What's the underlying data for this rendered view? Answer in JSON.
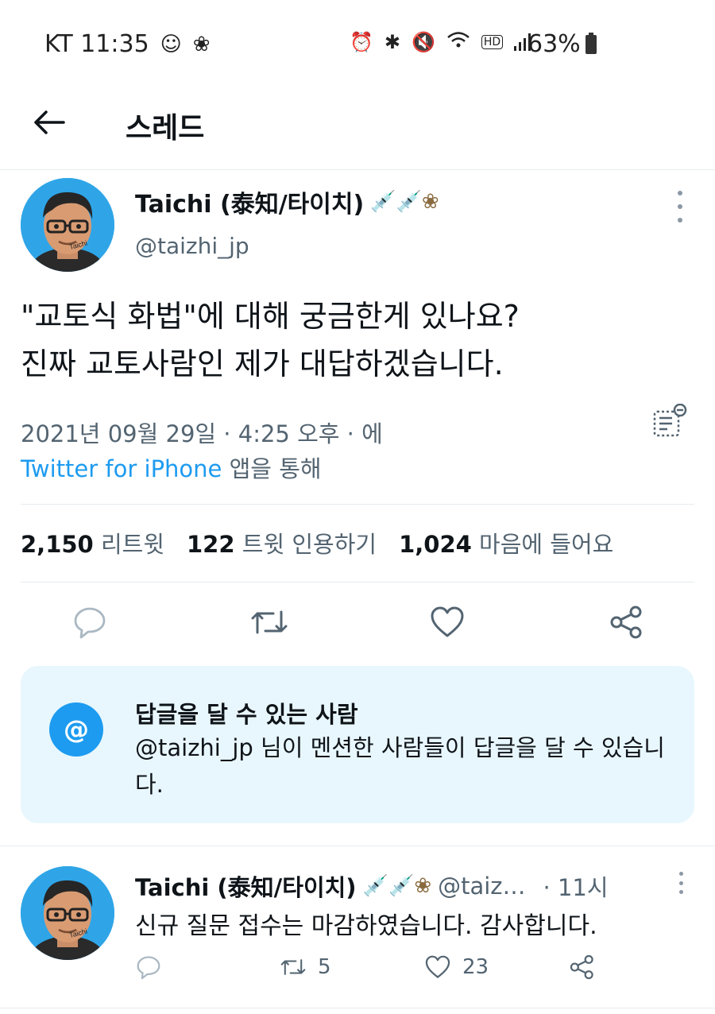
{
  "status_bar": {
    "carrier_time": "KT 11:35",
    "battery": "63%",
    "icons": [
      "person-icon",
      "flower-icon",
      "alarm-icon",
      "bluetooth-icon",
      "mute-icon",
      "wifi-icon",
      "hd-icon",
      "signal-icon",
      "battery-icon"
    ]
  },
  "header": {
    "title": "스레드"
  },
  "tweet": {
    "display_name": "Taichi (泰知/타이치)",
    "name_emoji": "💉💉❀",
    "handle": "@taizhi_jp",
    "text_line1": "\"교토식 화법\"에 대해 궁금한게 있나요?",
    "text_line2": "진짜 교토사람인 제가 대답하겠습니다.",
    "timestamp": "2021년 09월 29일 · 4:25 오후 · 에",
    "source_app": "Twitter for iPhone",
    "source_suffix": " 앱을 통해",
    "stats": {
      "retweets_count": "2,150",
      "retweets_label": "리트윗",
      "quotes_count": "122",
      "quotes_label": "트윗 인용하기",
      "likes_count": "1,024",
      "likes_label": "마음에 들어요"
    }
  },
  "reply_notice": {
    "icon_symbol": "@",
    "title": "답글을 달 수 있는 사람",
    "body": "@taizhi_jp 님이 멘션한 사람들이 답글을 달 수 있습니다."
  },
  "reply": {
    "display_name": "Taichi (泰知/타이치)",
    "name_emoji": "💉💉❀",
    "handle": "@taiz…",
    "time": "· 11시",
    "text": "신규 질문 접수는 마감하였습니다. 감사합니다.",
    "retweets": "5",
    "likes": "23"
  },
  "colors": {
    "accent": "#1d9bf0",
    "text": "#0f1419",
    "muted": "#536471",
    "notice_bg": "#e8f7fd"
  }
}
